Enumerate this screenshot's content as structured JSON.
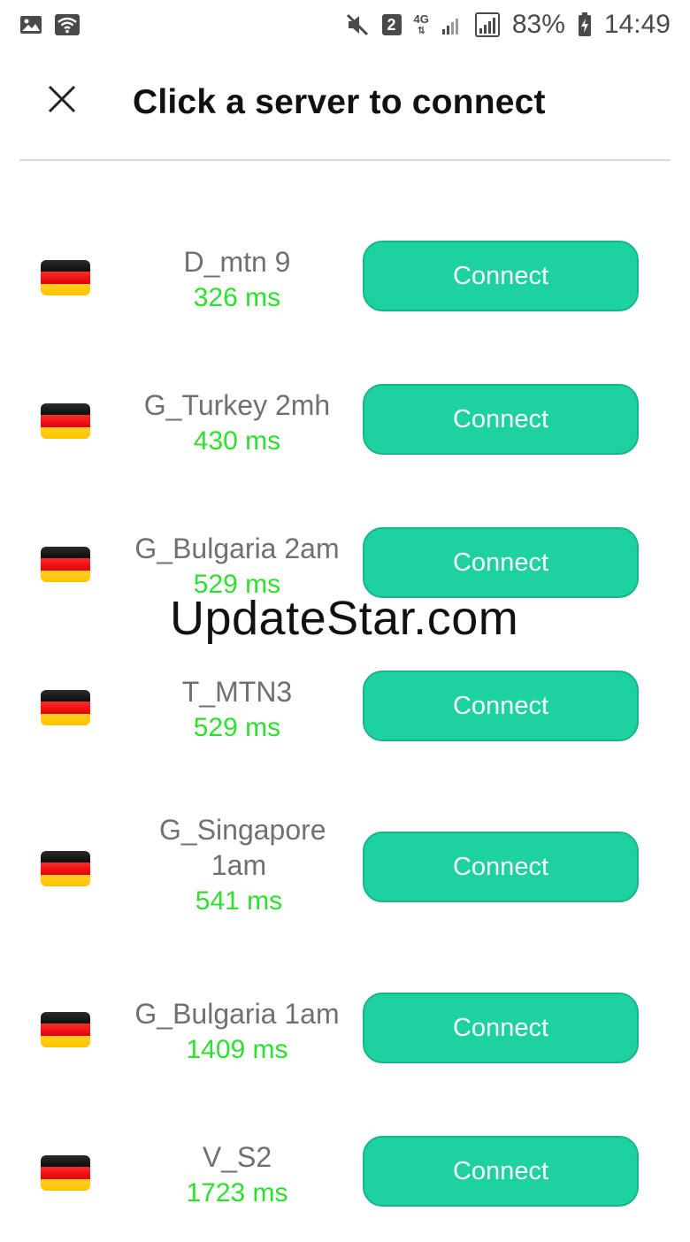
{
  "status_bar": {
    "sim_slot": "2",
    "network": "4G",
    "battery_percent": "83%",
    "time": "14:49"
  },
  "header": {
    "title": "Click a server to connect"
  },
  "servers": [
    {
      "name": "D_mtn 9",
      "ping": "326 ms",
      "button_label": "Connect",
      "flag": "germany-flag"
    },
    {
      "name": "G_Turkey 2mh",
      "ping": "430 ms",
      "button_label": "Connect",
      "flag": "germany-flag"
    },
    {
      "name": "G_Bulgaria 2am",
      "ping": "529 ms",
      "button_label": "Connect",
      "flag": "germany-flag"
    },
    {
      "name": "T_MTN3",
      "ping": "529 ms",
      "button_label": "Connect",
      "flag": "germany-flag"
    },
    {
      "name": "G_Singapore 1am",
      "ping": "541 ms",
      "button_label": "Connect",
      "flag": "germany-flag"
    },
    {
      "name": "G_Bulgaria 1am",
      "ping": "1409 ms",
      "button_label": "Connect",
      "flag": "germany-flag"
    },
    {
      "name": "V_S2",
      "ping": "1723 ms",
      "button_label": "Connect",
      "flag": "germany-flag"
    }
  ],
  "watermark": "UpdateStar.com",
  "colors": {
    "accent": "#1ed1a0",
    "ping": "#2ee02e",
    "server_name": "#707070"
  }
}
